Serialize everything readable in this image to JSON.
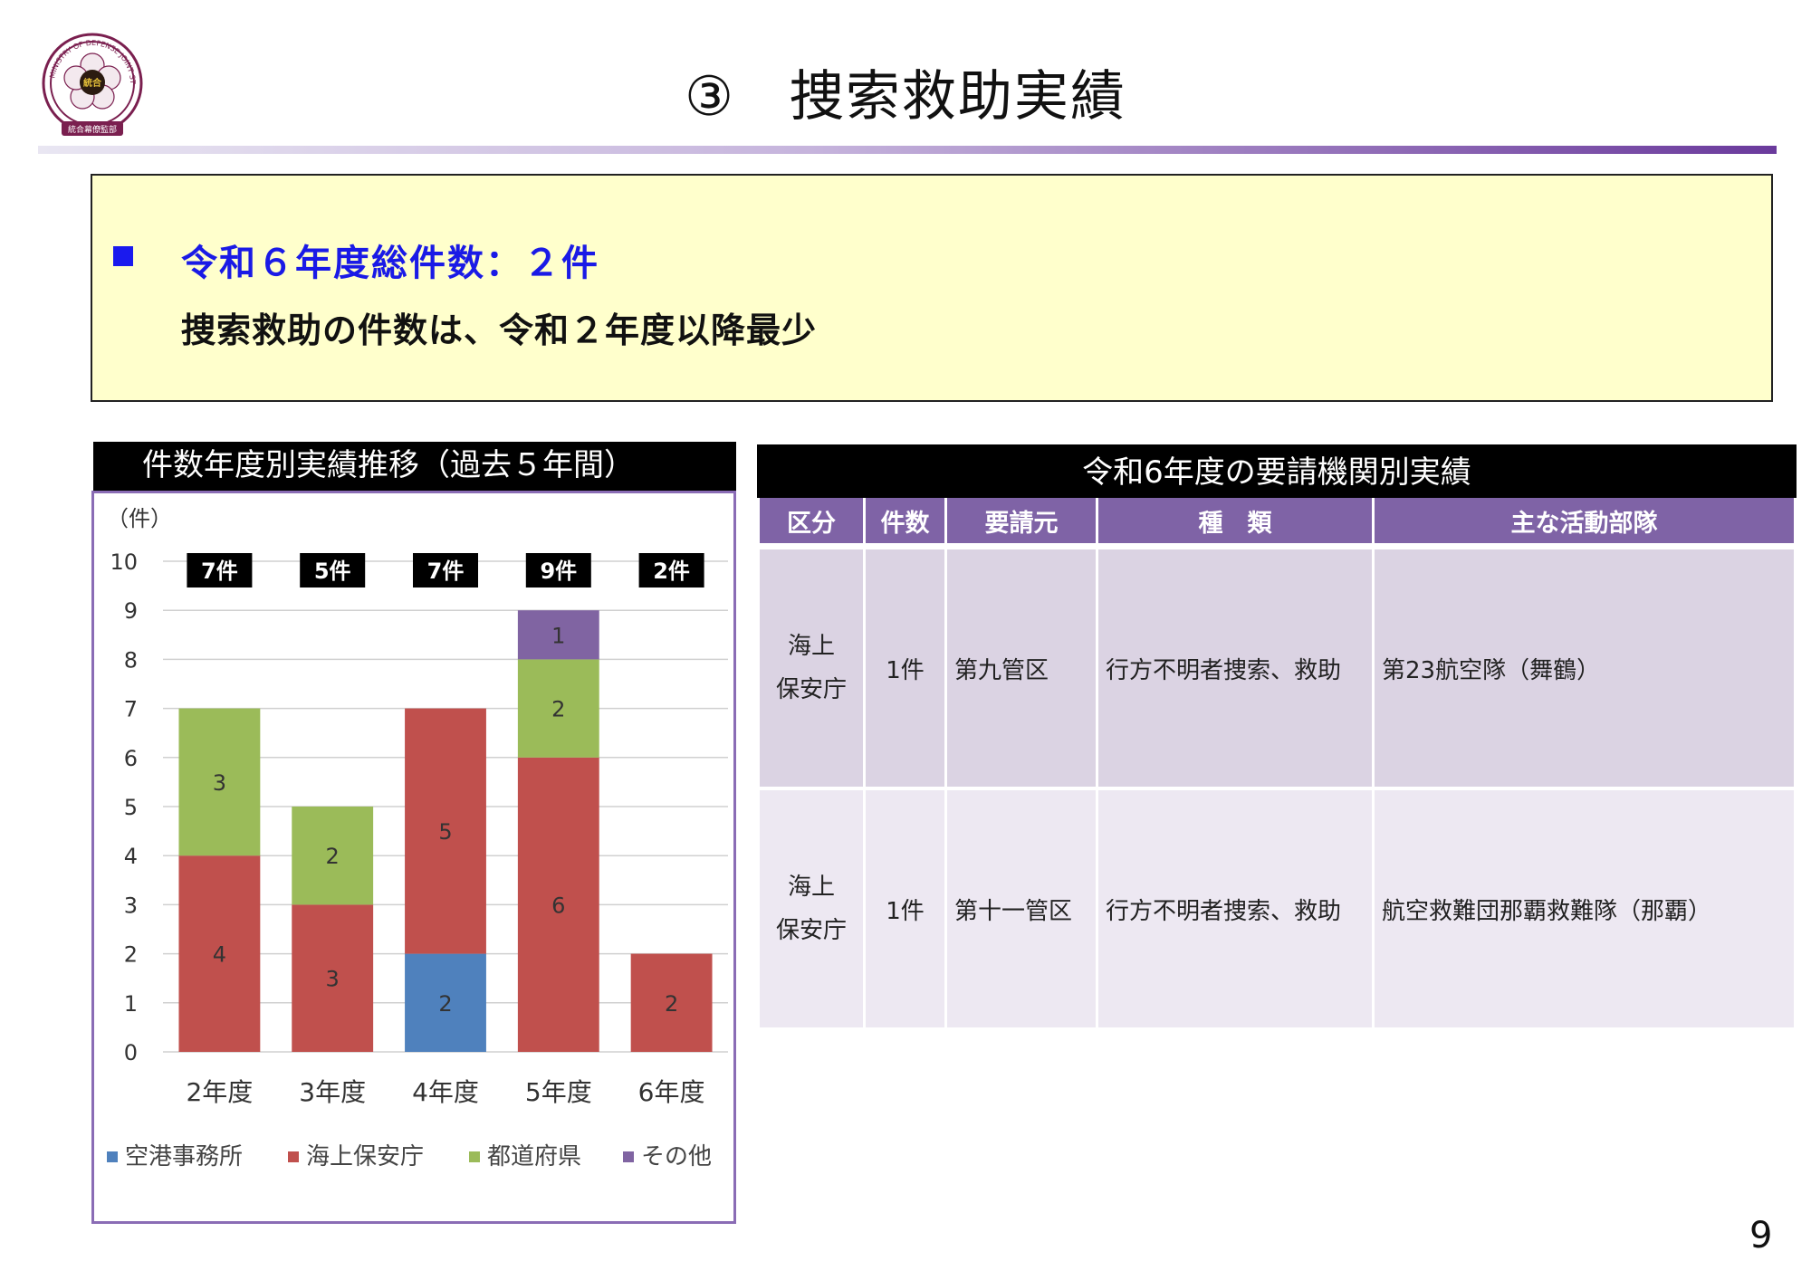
{
  "header": {
    "logo": {
      "ring_text_top": "MINISTRY OF DEFENSE  JOINT STAFF JAPAN",
      "center_text": "統合",
      "banner_text": "統合幕僚監部"
    },
    "title_number": "③",
    "title_text": "捜索救助実績"
  },
  "summary": {
    "line1": "令和６年度総件数：２件",
    "line2": "捜索救助の件数は、令和２年度以降最少"
  },
  "chart_panel": {
    "header": "件数年度別実績推移（過去５年間）"
  },
  "chart_data": {
    "type": "bar",
    "stacked": true,
    "unit_label": "（件）",
    "categories": [
      "2年度",
      "3年度",
      "4年度",
      "5年度",
      "6年度"
    ],
    "totals": [
      "7件",
      "5件",
      "7件",
      "9件",
      "2件"
    ],
    "ylim": [
      0,
      10
    ],
    "yticks": [
      0,
      1,
      2,
      3,
      4,
      5,
      6,
      7,
      8,
      9,
      10
    ],
    "grid": true,
    "legend_position": "bottom",
    "series": [
      {
        "name": "空港事務所",
        "color": "#4f81bd",
        "values": [
          0,
          0,
          2,
          0,
          0
        ]
      },
      {
        "name": "海上保安庁",
        "color": "#c0504d",
        "values": [
          4,
          3,
          5,
          6,
          2
        ]
      },
      {
        "name": "都道府県",
        "color": "#9bbb59",
        "values": [
          3,
          2,
          0,
          2,
          0
        ]
      },
      {
        "name": "その他",
        "color": "#8064a2",
        "values": [
          0,
          0,
          0,
          1,
          0
        ]
      }
    ]
  },
  "table": {
    "title": "令和6年度の要請機関別実績",
    "columns": [
      "区分",
      "件数",
      "要請元",
      "種　類",
      "主な活動部隊"
    ],
    "rows": [
      {
        "category_l1": "海上",
        "category_l2": "保安庁",
        "count": "1件",
        "requester": "第九管区",
        "type": "行方不明者捜索、救助",
        "unit": "第23航空隊（舞鶴）"
      },
      {
        "category_l1": "海上",
        "category_l2": "保安庁",
        "count": "1件",
        "requester": "第十一管区",
        "type": "行方不明者捜索、救助",
        "unit": "航空救難団那覇救難隊（那覇）"
      }
    ]
  },
  "page_number": "9",
  "colors": {
    "accent_purple": "#7f63a6",
    "summary_bg": "#ffffcc",
    "summary_blue": "#1a1ae6"
  }
}
